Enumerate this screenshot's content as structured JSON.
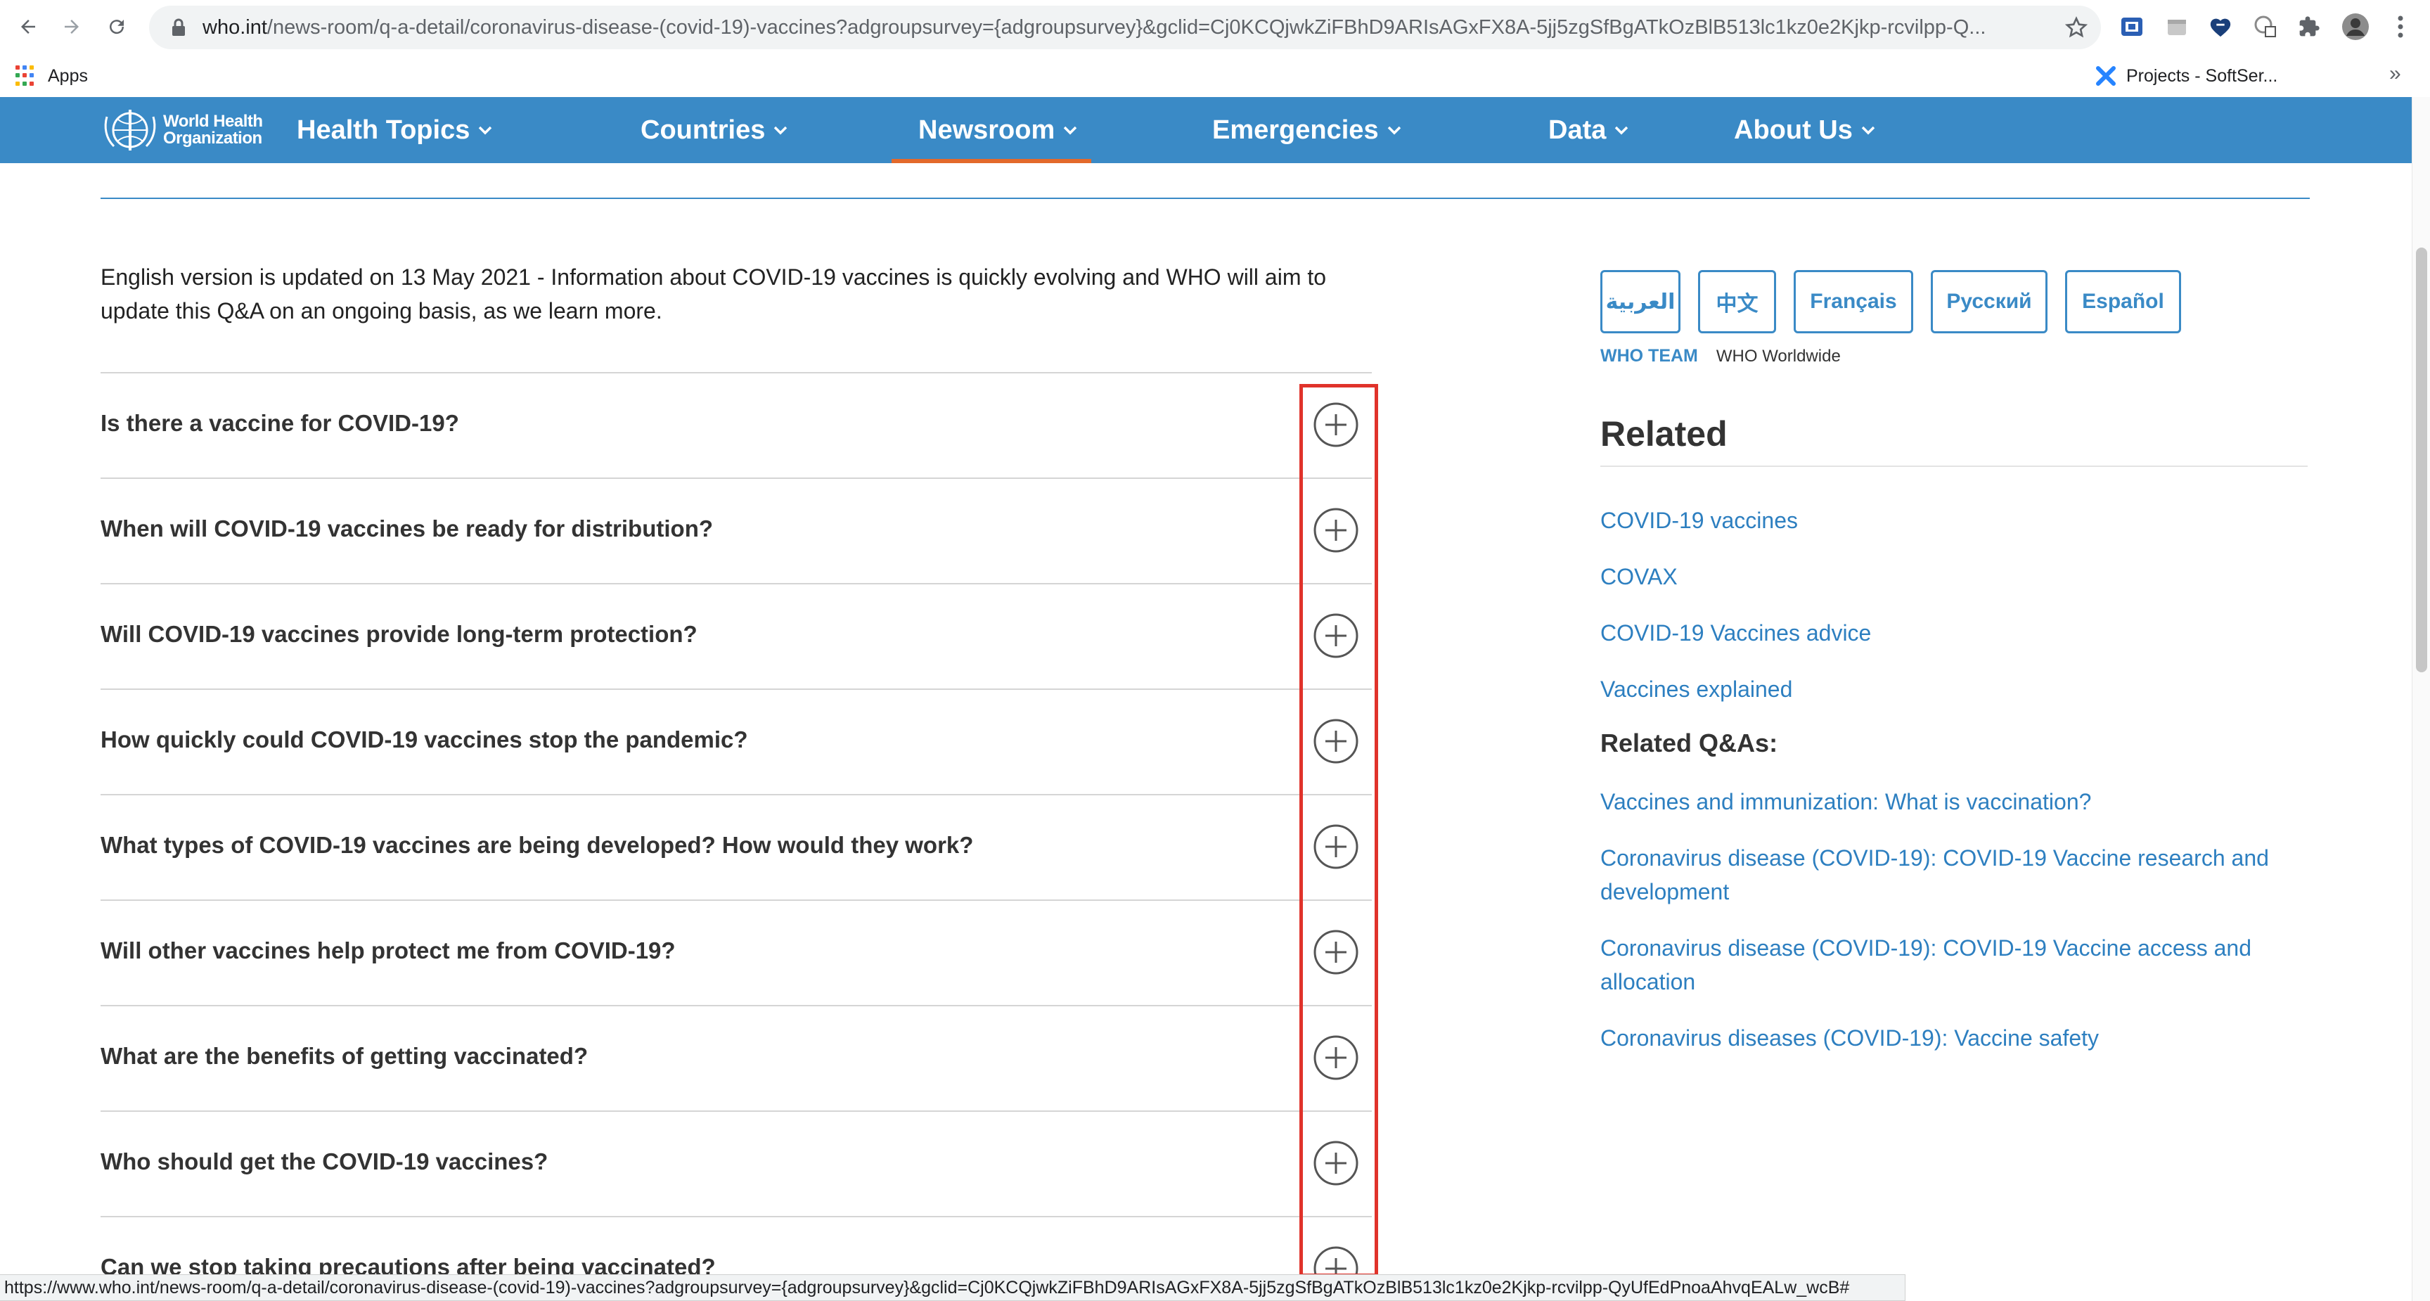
{
  "browser": {
    "url_host": "who.int",
    "url_path": "/news-room/q-a-detail/coronavirus-disease-(covid-19)-vaccines?adgroupsurvey={adgroupsurvey}&gclid=Cj0KCQjwkZiFBhD9ARIsAGxFX8A-5jj5zgSfBgATkOzBlB513lc1kz0e2Kjkp-rcvilpp-Q...",
    "bookmarks": {
      "apps_label": "Apps",
      "projects_label": "Projects - SoftSer..."
    },
    "status_url": "https://www.who.int/news-room/q-a-detail/coronavirus-disease-(covid-19)-vaccines?adgroupsurvey={adgroupsurvey}&gclid=Cj0KCQjwkZiFBhD9ARIsAGxFX8A-5jj5zgSfBgATkOzBlB513lc1kz0e2Kjkp-rcvilpp-QyUfEdPnoaAhvqEALw_wcB#"
  },
  "who_nav": {
    "logo_line1": "World Health",
    "logo_line2": "Organization",
    "items": [
      {
        "label": "Health Topics"
      },
      {
        "label": "Countries"
      },
      {
        "label": "Newsroom"
      },
      {
        "label": "Emergencies"
      },
      {
        "label": "Data"
      },
      {
        "label": "About Us"
      }
    ],
    "active": "Newsroom"
  },
  "content": {
    "intro": "English version is updated on 13 May 2021 - Information about COVID-19 vaccines is quickly evolving and WHO will aim to update this Q&A on an ongoing basis, as we learn more.",
    "questions": [
      "Is there a vaccine for COVID-19?",
      "When will COVID-19 vaccines be ready for distribution?",
      "Will COVID-19 vaccines provide long-term protection?",
      "How quickly could COVID-19 vaccines stop the pandemic?",
      "What types of COVID-19 vaccines are being developed? How would they work?",
      "Will other vaccines help protect me from COVID-19?",
      "What are the benefits of getting vaccinated?",
      "Who should get the COVID-19 vaccines?",
      "Can we stop taking precautions after being vaccinated?"
    ]
  },
  "sidebar": {
    "languages": [
      "العربية",
      "中文",
      "Français",
      "Русский",
      "Español"
    ],
    "team_label": "WHO TEAM",
    "team_value": "WHO Worldwide",
    "related_heading": "Related",
    "related_links": [
      "COVID-19 vaccines",
      "COVAX",
      "COVID-19 Vaccines advice",
      "Vaccines explained"
    ],
    "related_qas_heading": "Related Q&As:",
    "related_qas": [
      "Vaccines and immunization: What is vaccination?",
      "Coronavirus disease (COVID-19): COVID-19 Vaccine research and development",
      "Coronavirus disease (COVID-19): COVID-19 Vaccine access and allocation",
      "Coronavirus diseases (COVID-19): Vaccine safety"
    ]
  },
  "colors": {
    "who_blue": "#3a8ac6",
    "nav_active_underline": "#e3692b",
    "link_blue": "#2d7fc0",
    "highlight_red": "#e0332b"
  }
}
